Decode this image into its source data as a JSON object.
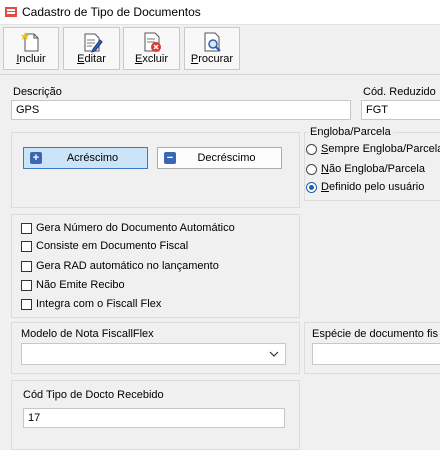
{
  "window": {
    "title": "Cadastro de Tipo de Documentos"
  },
  "toolbar": {
    "incluir": {
      "u": "I",
      "rest": "ncluir"
    },
    "editar": {
      "u": "E",
      "rest": "ditar"
    },
    "excluir": {
      "u": "E",
      "rest": "xcluir"
    },
    "procurar": {
      "u": "P",
      "rest": "rocurar"
    }
  },
  "form": {
    "descricao_label": "Descrição",
    "descricao_value": "GPS",
    "cod_reduzido_label": "Cód. Reduzido",
    "cod_reduzido_value": "FGT",
    "acrescimo_label": "Acréscimo",
    "decrescimo_label": "Decréscimo",
    "engloba_title": "Engloba/Parcela",
    "radio_sempre": {
      "u": "S",
      "rest": "empre Engloba/Parcela"
    },
    "radio_nao": {
      "u": "N",
      "rest": "ão Engloba/Parcela"
    },
    "radio_definido": {
      "u": "D",
      "rest": "efinido pelo usuário"
    },
    "radio_selected": "definido",
    "checks": [
      "Gera Número do Documento Automático",
      "Consiste em Documento Fiscal",
      "Gera RAD automático no lançamento",
      "Não Emite Recibo",
      "Integra com o Fiscall Flex"
    ],
    "modelo_label": "Modelo de Nota FiscallFlex",
    "modelo_value": "",
    "especie_label": "Espécie de documento fis",
    "cod_tipo_label": "Cód Tipo de Docto Recebido",
    "cod_tipo_value": "17"
  },
  "colors": {
    "accent": "#1a5fb4",
    "button_blue": "#3b66b4"
  }
}
